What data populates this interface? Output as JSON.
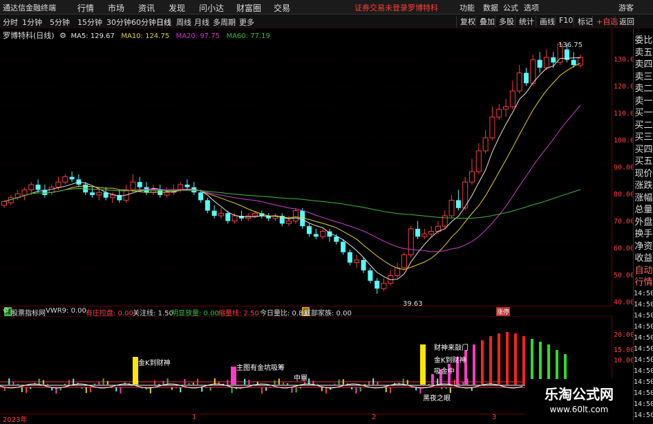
{
  "app": {
    "name": "通达信金融终端"
  },
  "menu": [
    "行情",
    "市场",
    "资讯",
    "发现",
    "问小达",
    "财富圈",
    "交易"
  ],
  "warning": "证券交易未登录",
  "stock_name_top": "罗博特科",
  "top_right": [
    "功能",
    "数据",
    "公式",
    "选项",
    "游客"
  ],
  "periods": [
    "分时",
    "1分钟",
    "5分钟",
    "15分钟",
    "30分钟",
    "60分钟",
    "日线",
    "周线",
    "月线",
    "多周期",
    "更多"
  ],
  "active_period": "日线",
  "toolbar": [
    "复权",
    "叠加",
    "多股",
    "统计",
    "画线",
    "F10",
    "标记",
    "+自选",
    "返回"
  ],
  "chart_title": "罗博特科(日线)",
  "ma": [
    {
      "label": "MA5: 129.67",
      "color": "#e6e6e6"
    },
    {
      "label": "MA10: 124.75",
      "color": "#e6d22a"
    },
    {
      "label": "MA20: 97.75",
      "color": "#d23cd2"
    },
    {
      "label": "MA60: 77.19",
      "color": "#3cbe3c"
    }
  ],
  "price_axis": [
    "130.0",
    "120.0",
    "110.0",
    "100.0",
    "90.00",
    "80.00",
    "70.00",
    "60.00",
    "50.00",
    "40.00"
  ],
  "high_label": "136.75",
  "low_label": "39.63",
  "markers": [
    "减",
    "预",
    "涨停"
  ],
  "sub": {
    "title": "股票指标网",
    "items": [
      {
        "label": "VWR9: 0.00",
        "color": "#ddd"
      },
      {
        "label": "有庄控盘: 0.00",
        "color": "#ff4040"
      },
      {
        "label": "关注线: 1.50",
        "color": "#ddd"
      },
      {
        "label": "明显放量: 0.00",
        "color": "#3cbe3c"
      },
      {
        "label": "缩量线: 2.50",
        "color": "#ff4040"
      },
      {
        "label": "今日量比: 0.83",
        "color": "#ddd"
      },
      {
        "label": "底部家族: 0.00",
        "color": "#ddd"
      }
    ],
    "axis": [
      "20.00",
      "15.00",
      "10.00"
    ],
    "annotations": [
      "金K到财神",
      "主图有金坑吸筹",
      "中畢",
      "财神来敲门",
      "金K到财神",
      "吸金中",
      "黑夜之眼"
    ]
  },
  "x_labels": [
    "2023年",
    "1",
    "2",
    "3"
  ],
  "side_items": [
    "委比",
    "卖五",
    "卖四",
    "卖三",
    "卖二",
    "卖一",
    "买一",
    "买二",
    "买三",
    "买四",
    "买五",
    "现价",
    "涨跌",
    "涨幅",
    "总量",
    "外盘",
    "换手",
    "净资",
    "收益",
    "自动",
    "行情"
  ],
  "time_items": [
    "14:50",
    "14:50",
    "14:50",
    "14:50",
    "14:50",
    "14:50",
    "14:50",
    "14:50",
    "14:50",
    "14:50",
    "14:50",
    "14:50"
  ],
  "watermark": {
    "title": "乐淘公式网",
    "url": "www.60lt.com"
  },
  "chart_data": {
    "type": "candlestick",
    "ylim": [
      37,
      140
    ],
    "ma_values": {
      "MA5": 129.67,
      "MA10": 124.75,
      "MA20": 97.75,
      "MA60": 77.19
    },
    "candles": [
      [
        74,
        75.5,
        73,
        76
      ],
      [
        75,
        77,
        74,
        78
      ],
      [
        77,
        78.5,
        76,
        80
      ],
      [
        78,
        80,
        76,
        81
      ],
      [
        80,
        82,
        78,
        83
      ],
      [
        82,
        80,
        79,
        84
      ],
      [
        80,
        78,
        77,
        82
      ],
      [
        79,
        81,
        78,
        82
      ],
      [
        81,
        83,
        80,
        85
      ],
      [
        83,
        85,
        82,
        86
      ],
      [
        85,
        84,
        83,
        87
      ],
      [
        84,
        82,
        81,
        86
      ],
      [
        82,
        79,
        78,
        83
      ],
      [
        79,
        78,
        77,
        81
      ],
      [
        78,
        79,
        76,
        80
      ],
      [
        79,
        77,
        76,
        81
      ],
      [
        77,
        78,
        75,
        79
      ],
      [
        78,
        76,
        75,
        80
      ],
      [
        76,
        80,
        75,
        82
      ],
      [
        80,
        83,
        79,
        86
      ],
      [
        83,
        81,
        80,
        85
      ],
      [
        81,
        79,
        78,
        83
      ],
      [
        79,
        80,
        78,
        82
      ],
      [
        80,
        78,
        77,
        82
      ],
      [
        78,
        79,
        77,
        81
      ],
      [
        79,
        80,
        78,
        82
      ],
      [
        80,
        82,
        79,
        83
      ],
      [
        82,
        81,
        80,
        84
      ],
      [
        81,
        79,
        78,
        83
      ],
      [
        79,
        76,
        75,
        80
      ],
      [
        76,
        72,
        71,
        77
      ],
      [
        72,
        70,
        69,
        74
      ],
      [
        70,
        71,
        69,
        73
      ],
      [
        71,
        68,
        67,
        72
      ],
      [
        68,
        70,
        67,
        71
      ],
      [
        70,
        69,
        68,
        72
      ],
      [
        69,
        70,
        68,
        71
      ],
      [
        70,
        71,
        69,
        72
      ],
      [
        71,
        70,
        69,
        72
      ],
      [
        70,
        69,
        68,
        71
      ],
      [
        69,
        70,
        68,
        71
      ],
      [
        70,
        67,
        66,
        71
      ],
      [
        67,
        68,
        66,
        70
      ],
      [
        68,
        72,
        67,
        73
      ],
      [
        72,
        66,
        65,
        73
      ],
      [
        66,
        63,
        62,
        67
      ],
      [
        63,
        62,
        61,
        65
      ],
      [
        62,
        64,
        61,
        65
      ],
      [
        64,
        62,
        60,
        65
      ],
      [
        62,
        60,
        59,
        63
      ],
      [
        60,
        56,
        55,
        61
      ],
      [
        56,
        52,
        51,
        57
      ],
      [
        52,
        53,
        50,
        55
      ],
      [
        53,
        49,
        48,
        54
      ],
      [
        49,
        45,
        44,
        50
      ],
      [
        45,
        42,
        40,
        46
      ],
      [
        42,
        44,
        41,
        46
      ],
      [
        44,
        47,
        43,
        49
      ],
      [
        47,
        50,
        46,
        52
      ],
      [
        50,
        55,
        49,
        56
      ],
      [
        55,
        65,
        54,
        66
      ],
      [
        65,
        62,
        61,
        68
      ],
      [
        62,
        63,
        61,
        65
      ],
      [
        63,
        64,
        62,
        66
      ],
      [
        64,
        66,
        63,
        68
      ],
      [
        66,
        70,
        65,
        72
      ],
      [
        70,
        76,
        69,
        78
      ],
      [
        76,
        73,
        72,
        80
      ],
      [
        73,
        83,
        72,
        85
      ],
      [
        83,
        87,
        82,
        92
      ],
      [
        87,
        95,
        86,
        98
      ],
      [
        95,
        100,
        94,
        103
      ],
      [
        100,
        108,
        99,
        112
      ],
      [
        108,
        111,
        107,
        113
      ],
      [
        111,
        112,
        108,
        115
      ],
      [
        112,
        118,
        111,
        122
      ],
      [
        118,
        125,
        117,
        128
      ],
      [
        125,
        121,
        120,
        127
      ],
      [
        121,
        130,
        120,
        132
      ],
      [
        130,
        127,
        125,
        133
      ],
      [
        127,
        131,
        126,
        134
      ],
      [
        131,
        129,
        127,
        133
      ],
      [
        129,
        136,
        128,
        136.75
      ],
      [
        134,
        130,
        129,
        136
      ],
      [
        130,
        128,
        127,
        133
      ],
      [
        128,
        131,
        127,
        132
      ]
    ]
  }
}
